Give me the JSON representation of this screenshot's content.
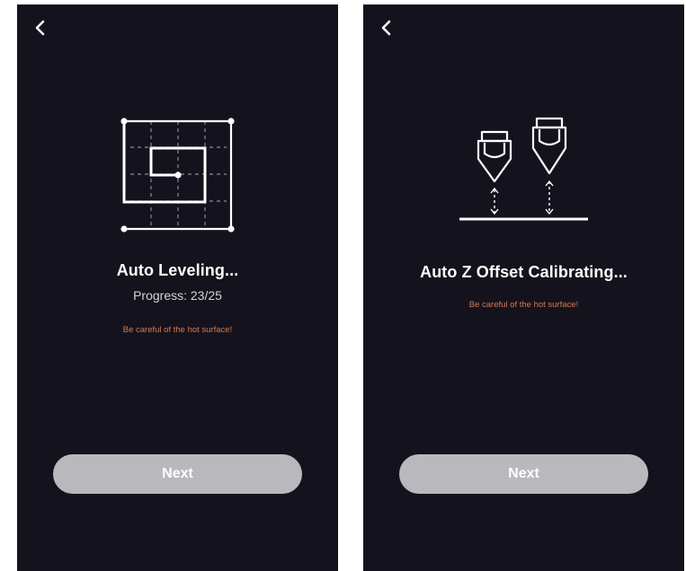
{
  "leveling_screen": {
    "back_icon": "chevron-left-icon",
    "illustration_icon": "bed-leveling-grid-icon",
    "title": "Auto Leveling...",
    "progress": "Progress: 23/25",
    "progress_value": {
      "current": 23,
      "total": 25
    },
    "warning": "Be careful of the hot surface!",
    "next_label": "Next"
  },
  "z_offset_screen": {
    "back_icon": "chevron-left-icon",
    "illustration_icon": "nozzle-z-offset-icon",
    "title": "Auto Z Offset Calibrating...",
    "warning": "Be careful of the hot surface!",
    "next_label": "Next"
  },
  "colors": {
    "background": "#14131d",
    "text": "#ffffff",
    "warning": "#d9784e",
    "button_disabled": "#b9b9bd"
  }
}
